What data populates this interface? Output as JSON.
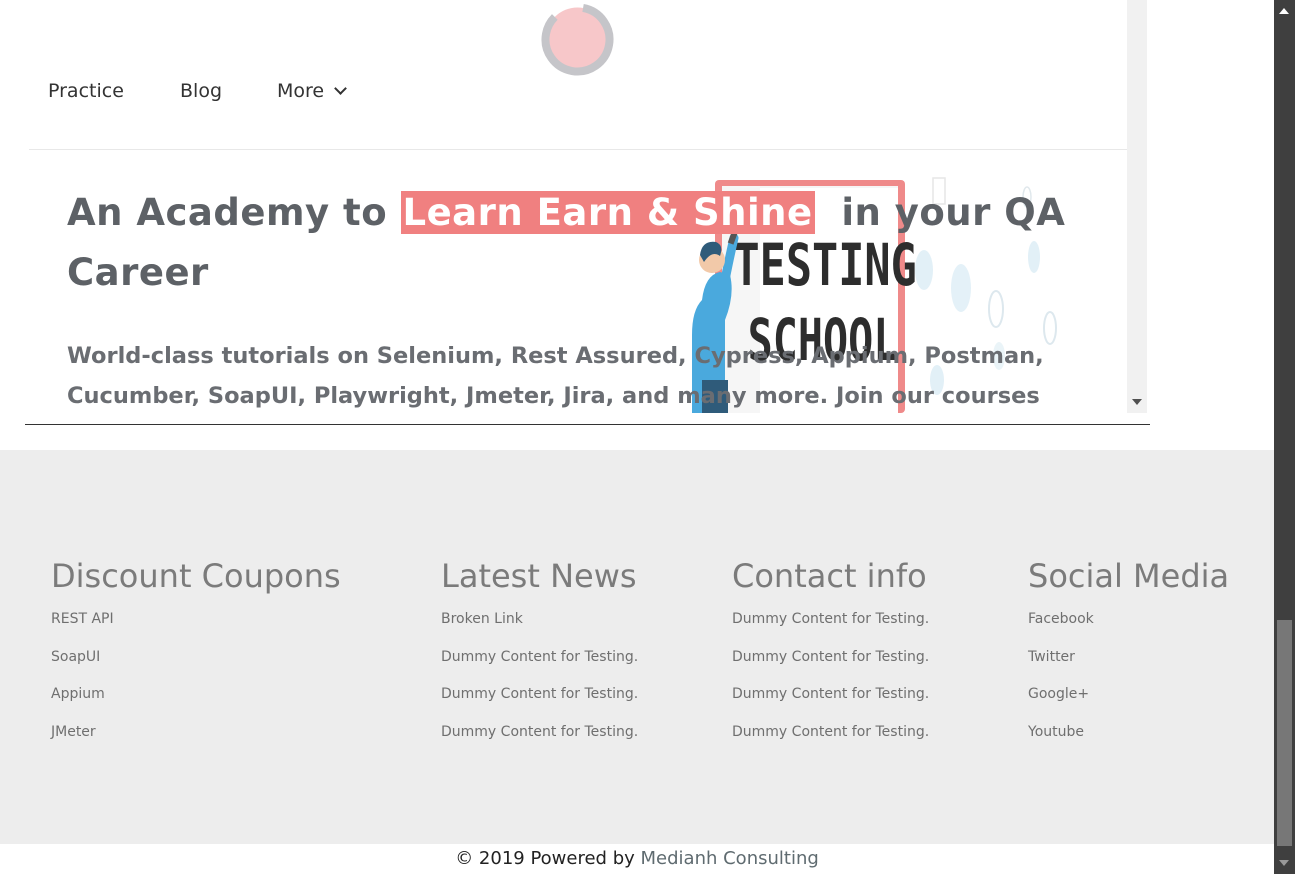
{
  "nav": {
    "items": [
      "Practice",
      "Blog",
      "More"
    ]
  },
  "hero": {
    "title_before": "An Academy to ",
    "title_highlight": "Learn Earn & Shine",
    "title_after": "  in your QA Career",
    "subtitle": "World-class tutorials on Selenium, Rest Assured, Cypress, Appium, Postman, Cucumber, SoapUI, Playwright, Jmeter, Jira, and many more. Join our courses now to get the best job",
    "image_text_1": "TESTING",
    "image_text_2": "SCHOOL"
  },
  "footer": {
    "columns": [
      {
        "title": "Discount Coupons",
        "links": [
          "REST API",
          "SoapUI",
          "Appium",
          "JMeter"
        ]
      },
      {
        "title": "Latest News",
        "links": [
          "Broken Link",
          "Dummy Content for Testing.",
          "Dummy Content for Testing.",
          "Dummy Content for Testing."
        ]
      },
      {
        "title": "Contact info",
        "links": [
          "Dummy Content for Testing.",
          "Dummy Content for Testing.",
          "Dummy Content for Testing.",
          "Dummy Content for Testing."
        ]
      },
      {
        "title": "Social Media",
        "links": [
          "Facebook",
          "Twitter",
          "Google+",
          "Youtube"
        ]
      }
    ],
    "copyright_prefix": "© 2019 Powered by ",
    "copyright_brand": "Medianh Consulting"
  },
  "colors": {
    "highlight": "#f08080",
    "footer_bg": "#ededed",
    "heading_text": "#5d6166"
  }
}
